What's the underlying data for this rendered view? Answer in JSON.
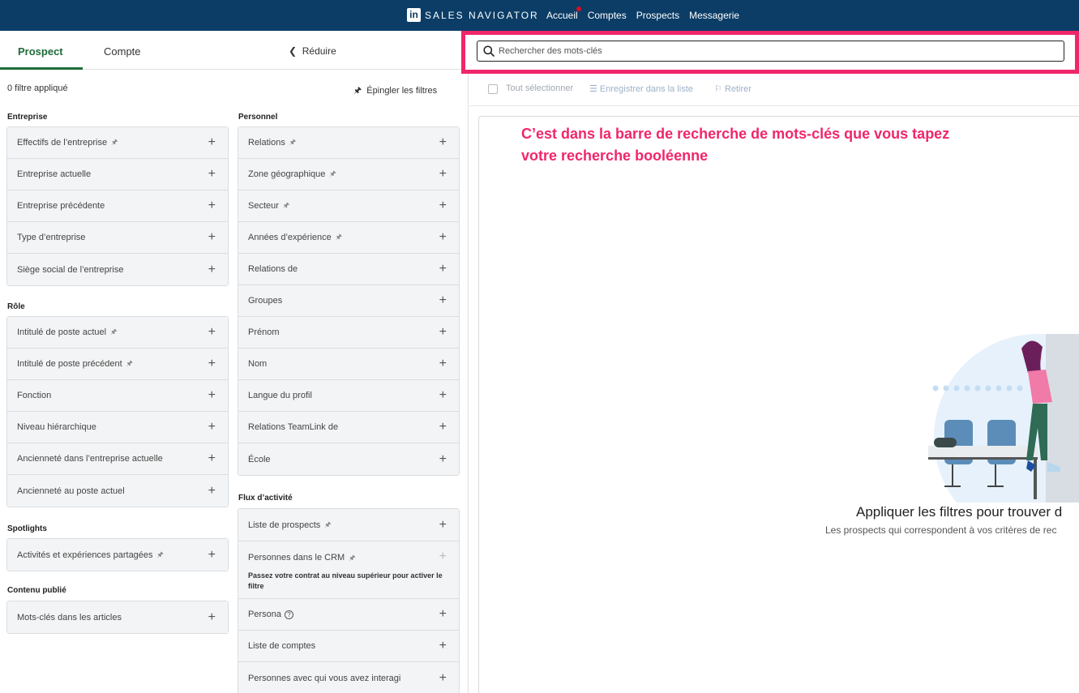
{
  "nav": {
    "brand": "SALES NAVIGATOR",
    "logo": "in",
    "links": [
      "Accueil",
      "Comptes",
      "Prospects",
      "Messagerie"
    ]
  },
  "left": {
    "tabs": {
      "prospect": "Prospect",
      "compte": "Compte"
    },
    "reduce": "Réduire",
    "filter_count": "0 filtre appliqué",
    "pin_filters": "Épingler les filtres",
    "sections": {
      "entreprise": {
        "title": "Entreprise",
        "items": [
          "Effectifs de l’entreprise",
          "Entreprise actuelle",
          "Entreprise précédente",
          "Type d’entreprise",
          "Siège social de l’entreprise"
        ]
      },
      "role": {
        "title": "Rôle",
        "items": [
          "Intitulé de poste actuel",
          "Intitulé de poste précédent",
          "Fonction",
          "Niveau hiérarchique",
          "Ancienneté dans l’entreprise actuelle",
          "Ancienneté au poste actuel"
        ]
      },
      "spotlights": {
        "title": "Spotlights",
        "items": [
          "Activités et expériences partagées"
        ]
      },
      "contenu": {
        "title": "Contenu publié",
        "items": [
          "Mots-clés dans les articles"
        ]
      },
      "personnel": {
        "title": "Personnel",
        "items": [
          "Relations",
          "Zone géographique",
          "Secteur",
          "Années d’expérience",
          "Relations de",
          "Groupes",
          "Prénom",
          "Nom",
          "Langue du profil",
          "Relations TeamLink de",
          "École"
        ]
      },
      "flux": {
        "title": "Flux d’activité",
        "items": [
          "Liste de prospects",
          "Personnes dans le CRM",
          "Persona",
          "Liste de comptes",
          "Personnes avec qui vous avez interagi"
        ],
        "crm_note": "Passez votre contrat au niveau supérieur pour activer le filtre"
      }
    }
  },
  "search": {
    "placeholder": "Rechercher des mots-clés"
  },
  "toolbar": {
    "select_all": "Tout sélectionner",
    "save": "Enregistrer dans la liste",
    "remove": "Retirer"
  },
  "annotation": "C’est dans la barre de recherche de mots-clés que vous tapez votre recherche booléenne",
  "empty": {
    "title": "Appliquer les filtres pour trouver d",
    "subtitle": "Les prospects qui correspondent à vos critères de rec"
  },
  "colors": {
    "nav_bg": "#0b3d66",
    "accent_green": "#1e6b3a",
    "highlight_pink": "#f0266b"
  }
}
